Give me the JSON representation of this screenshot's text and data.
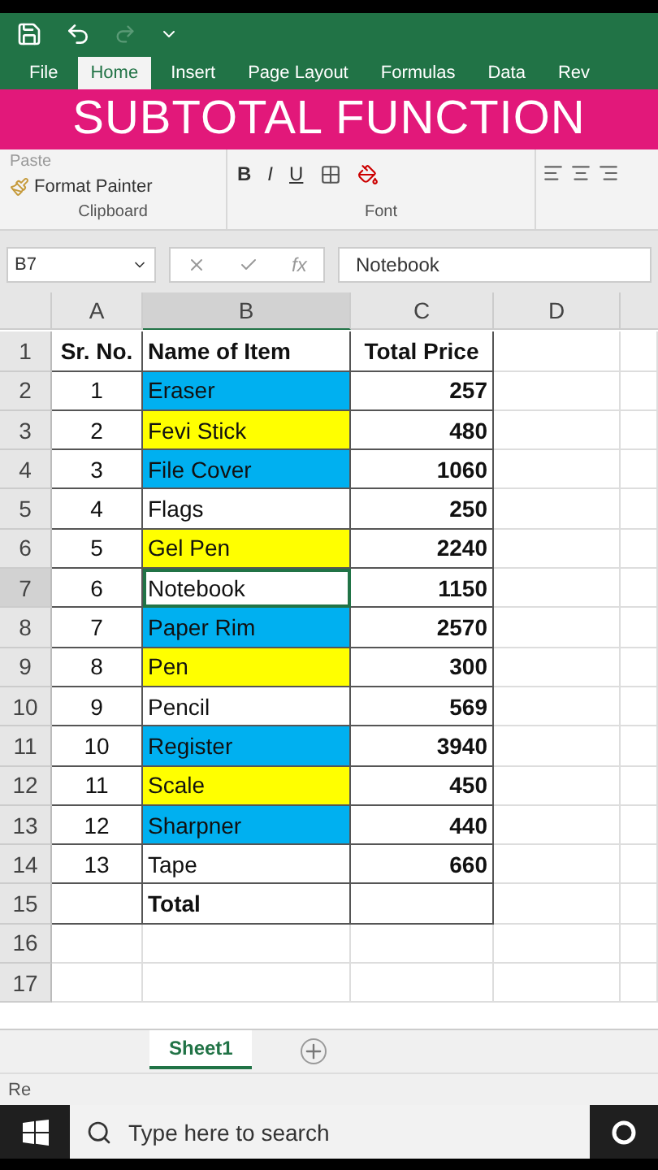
{
  "tabs": [
    {
      "label": "File",
      "selected": false
    },
    {
      "label": "Home",
      "selected": true
    },
    {
      "label": "Insert",
      "selected": false
    },
    {
      "label": "Page Layout",
      "selected": false
    },
    {
      "label": "Formulas",
      "selected": false
    },
    {
      "label": "Data",
      "selected": false
    },
    {
      "label": "Rev",
      "selected": false
    }
  ],
  "banner": "SUBTOTAL FUNCTION",
  "ribbon": {
    "paste": "Paste",
    "format_painter": "Format Painter",
    "font_buttons": [
      "B",
      "I",
      "U"
    ],
    "groups": [
      "Clipboard",
      "Font"
    ]
  },
  "formula_bar": {
    "name_box": "B7",
    "fx": "fx",
    "value": "Notebook"
  },
  "columns": [
    {
      "label": "A",
      "selected": false
    },
    {
      "label": "B",
      "selected": true
    },
    {
      "label": "C",
      "selected": false
    },
    {
      "label": "D",
      "selected": false
    }
  ],
  "rows": [
    {
      "num": "1",
      "a": "Sr. No.",
      "b": "Name of Item",
      "c": "Total Price",
      "kind": "header",
      "selected": false
    },
    {
      "num": "2",
      "a": "1",
      "b": "Eraser",
      "c": "257",
      "kind": "data",
      "color": "#00b0f0",
      "selected": false
    },
    {
      "num": "3",
      "a": "2",
      "b": "Fevi Stick",
      "c": "480",
      "kind": "data",
      "color": "#ffff00",
      "selected": false
    },
    {
      "num": "4",
      "a": "3",
      "b": "File Cover",
      "c": "1060",
      "kind": "data",
      "color": "#00b0f0",
      "selected": false
    },
    {
      "num": "5",
      "a": "4",
      "b": "Flags",
      "c": "250",
      "kind": "data",
      "color": "#ffffff",
      "selected": false
    },
    {
      "num": "6",
      "a": "5",
      "b": "Gel Pen",
      "c": "2240",
      "kind": "data",
      "color": "#ffff00",
      "selected": false
    },
    {
      "num": "7",
      "a": "6",
      "b": "Notebook",
      "c": "1150",
      "kind": "data",
      "color": "#ffffff",
      "selected": true
    },
    {
      "num": "8",
      "a": "7",
      "b": "Paper Rim",
      "c": "2570",
      "kind": "data",
      "color": "#00b0f0",
      "selected": false
    },
    {
      "num": "9",
      "a": "8",
      "b": "Pen",
      "c": "300",
      "kind": "data",
      "color": "#ffff00",
      "selected": false
    },
    {
      "num": "10",
      "a": "9",
      "b": "Pencil",
      "c": "569",
      "kind": "data",
      "color": "#ffffff",
      "selected": false
    },
    {
      "num": "11",
      "a": "10",
      "b": "Register",
      "c": "3940",
      "kind": "data",
      "color": "#00b0f0",
      "selected": false
    },
    {
      "num": "12",
      "a": "11",
      "b": "Scale",
      "c": "450",
      "kind": "data",
      "color": "#ffff00",
      "selected": false
    },
    {
      "num": "13",
      "a": "12",
      "b": "Sharpner",
      "c": "440",
      "kind": "data",
      "color": "#00b0f0",
      "selected": false
    },
    {
      "num": "14",
      "a": "13",
      "b": "Tape",
      "c": "660",
      "kind": "data",
      "color": "#ffffff",
      "selected": false
    },
    {
      "num": "15",
      "b": "Total",
      "kind": "total",
      "selected": false
    },
    {
      "num": "16",
      "kind": "empty",
      "selected": false
    },
    {
      "num": "17",
      "kind": "empty",
      "selected": false
    }
  ],
  "sheet_tabs": [
    {
      "label": "Sheet1",
      "selected": true
    }
  ],
  "status": "Re",
  "taskbar": {
    "search_placeholder": "Type here to search"
  }
}
